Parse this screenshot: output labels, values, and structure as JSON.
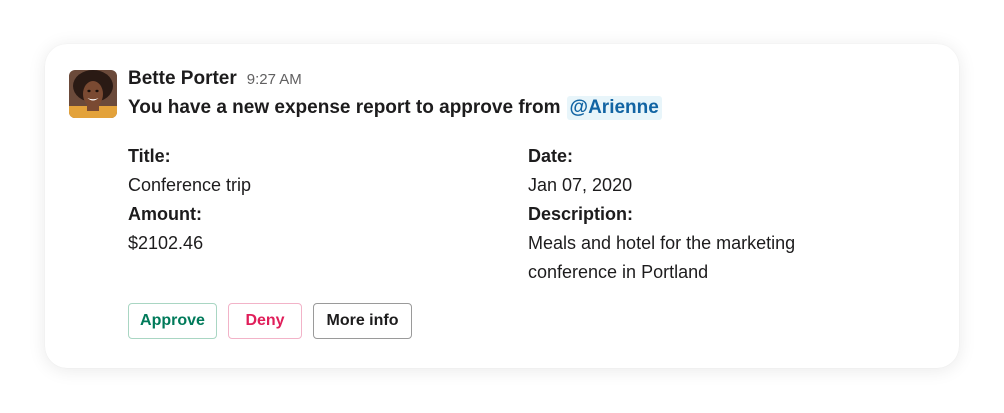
{
  "message": {
    "sender": "Bette Porter",
    "timestamp": "9:27 AM",
    "text": "You have a new expense report to approve from",
    "mention": "@Arienne"
  },
  "fields": {
    "title_label": "Title:",
    "title_value": "Conference trip",
    "amount_label": "Amount:",
    "amount_value": "$2102.46",
    "date_label": "Date:",
    "date_value": "Jan 07, 2020",
    "description_label": "Description:",
    "description_value": "Meals and hotel for the marketing conference in Portland"
  },
  "actions": {
    "approve_label": "Approve",
    "deny_label": "Deny",
    "more_info_label": "More info"
  },
  "colors": {
    "approve": "#007a5a",
    "deny": "#e01e5a",
    "mention_text": "#1264a3",
    "mention_bg": "#e8f5fa"
  }
}
